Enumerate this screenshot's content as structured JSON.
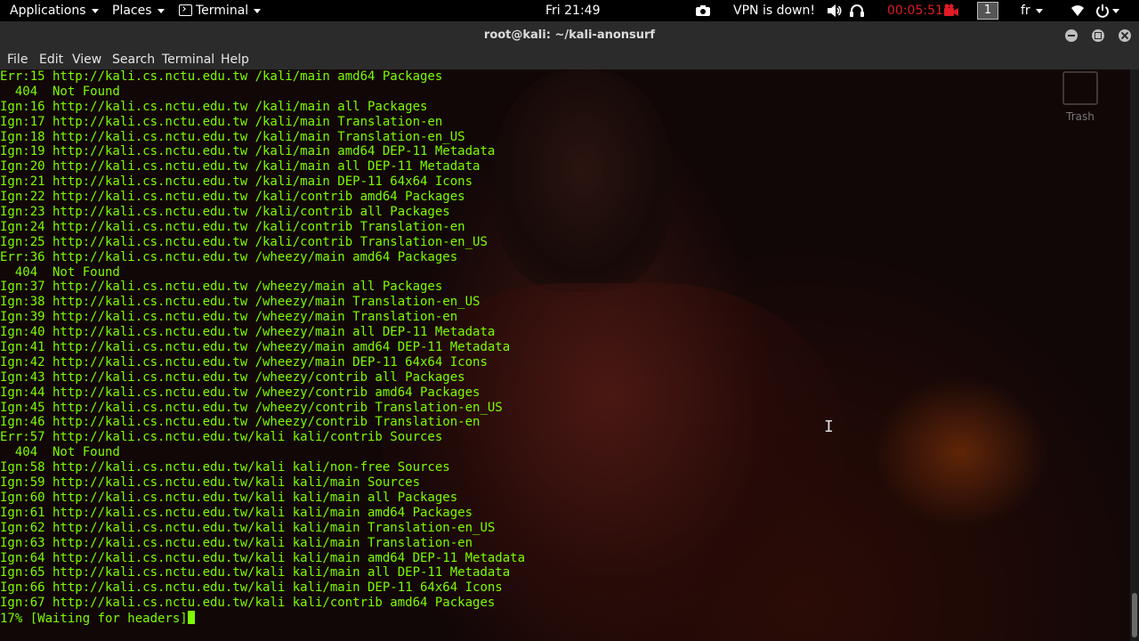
{
  "top_panel": {
    "applications": "Applications",
    "places": "Places",
    "terminal": "Terminal",
    "clock": "Fri 21:49",
    "vpn_status": "VPN is down!",
    "recording_timer": "00:05:51",
    "workspace": "1",
    "keyboard_layout": "fr",
    "colors": {
      "timer": "#e01b24"
    }
  },
  "window": {
    "title": "root@kali: ~/kali-anonsurf"
  },
  "menubar": {
    "items": [
      "File",
      "Edit",
      "View",
      "Search",
      "Terminal",
      "Help"
    ]
  },
  "desktop": {
    "trash_label": "Trash"
  },
  "terminal": {
    "text_color": "#7cfc00",
    "lines": [
      "Err:15 http://kali.cs.nctu.edu.tw /kali/main amd64 Packages",
      "  404  Not Found",
      "Ign:16 http://kali.cs.nctu.edu.tw /kali/main all Packages",
      "Ign:17 http://kali.cs.nctu.edu.tw /kali/main Translation-en",
      "Ign:18 http://kali.cs.nctu.edu.tw /kali/main Translation-en_US",
      "Ign:19 http://kali.cs.nctu.edu.tw /kali/main amd64 DEP-11 Metadata",
      "Ign:20 http://kali.cs.nctu.edu.tw /kali/main all DEP-11 Metadata",
      "Ign:21 http://kali.cs.nctu.edu.tw /kali/main DEP-11 64x64 Icons",
      "Ign:22 http://kali.cs.nctu.edu.tw /kali/contrib amd64 Packages",
      "Ign:23 http://kali.cs.nctu.edu.tw /kali/contrib all Packages",
      "Ign:24 http://kali.cs.nctu.edu.tw /kali/contrib Translation-en",
      "Ign:25 http://kali.cs.nctu.edu.tw /kali/contrib Translation-en_US",
      "Err:36 http://kali.cs.nctu.edu.tw /wheezy/main amd64 Packages",
      "  404  Not Found",
      "Ign:37 http://kali.cs.nctu.edu.tw /wheezy/main all Packages",
      "Ign:38 http://kali.cs.nctu.edu.tw /wheezy/main Translation-en_US",
      "Ign:39 http://kali.cs.nctu.edu.tw /wheezy/main Translation-en",
      "Ign:40 http://kali.cs.nctu.edu.tw /wheezy/main all DEP-11 Metadata",
      "Ign:41 http://kali.cs.nctu.edu.tw /wheezy/main amd64 DEP-11 Metadata",
      "Ign:42 http://kali.cs.nctu.edu.tw /wheezy/main DEP-11 64x64 Icons",
      "Ign:43 http://kali.cs.nctu.edu.tw /wheezy/contrib all Packages",
      "Ign:44 http://kali.cs.nctu.edu.tw /wheezy/contrib amd64 Packages",
      "Ign:45 http://kali.cs.nctu.edu.tw /wheezy/contrib Translation-en_US",
      "Ign:46 http://kali.cs.nctu.edu.tw /wheezy/contrib Translation-en",
      "Err:57 http://kali.cs.nctu.edu.tw/kali kali/contrib Sources",
      "  404  Not Found",
      "Ign:58 http://kali.cs.nctu.edu.tw/kali kali/non-free Sources",
      "Ign:59 http://kali.cs.nctu.edu.tw/kali kali/main Sources",
      "Ign:60 http://kali.cs.nctu.edu.tw/kali kali/main all Packages",
      "Ign:61 http://kali.cs.nctu.edu.tw/kali kali/main amd64 Packages",
      "Ign:62 http://kali.cs.nctu.edu.tw/kali kali/main Translation-en_US",
      "Ign:63 http://kali.cs.nctu.edu.tw/kali kali/main Translation-en",
      "Ign:64 http://kali.cs.nctu.edu.tw/kali kali/main amd64 DEP-11 Metadata",
      "Ign:65 http://kali.cs.nctu.edu.tw/kali kali/main all DEP-11 Metadata",
      "Ign:66 http://kali.cs.nctu.edu.tw/kali kali/main DEP-11 64x64 Icons",
      "Ign:67 http://kali.cs.nctu.edu.tw/kali kali/contrib amd64 Packages",
      "17% [Waiting for headers]"
    ]
  }
}
